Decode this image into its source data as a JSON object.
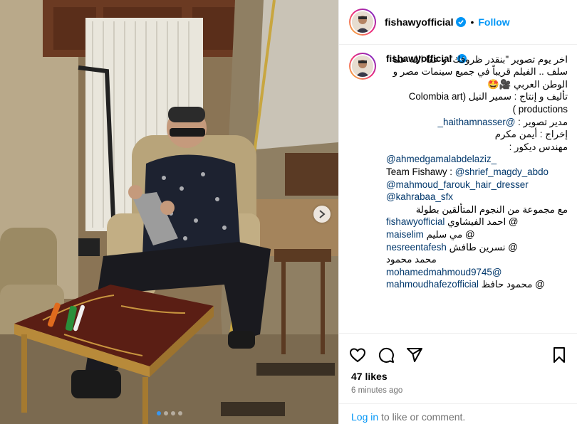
{
  "post": {
    "username": "fishawyofficial",
    "separator": "•",
    "follow_label": "Follow",
    "caption": {
      "lines": [
        {
          "text": "اخر يوم تصوير \"بنقدر ظروفك\" و عفا الله عما سلف .. الفيلم قريباً في جميع سينمات مصر و الوطن العربي 🎥🤩",
          "dir": "rtl"
        },
        {
          "text": "تأليف و إنتاج : سمير النيل (Colombia art productions )",
          "dir": "rtl"
        },
        {
          "text": "مدير تصوير : @haithamnasser_",
          "dir": "rtl",
          "has_link": true,
          "plain": "مدير تصوير : ",
          "link": "@haithamnasser_"
        },
        {
          "text": "إخراج : أيمن مكرم",
          "dir": "rtl"
        },
        {
          "text": "مهندس ديكور :",
          "dir": "rtl"
        },
        {
          "text": "@ahmedgamalabdelaziz_",
          "dir": "ltr",
          "link_only": true
        },
        {
          "text": "Team Fishawy :",
          "dir": "ltr"
        },
        {
          "text": "مع مجموعة من النجوم المتألقين بطولة",
          "dir": "rtl"
        },
        {
          "text": "احمد الفيشاوي",
          "dir": "ltr"
        },
        {
          "text": "مي سليم",
          "dir": "ltr"
        },
        {
          "text": "نسرين طافش",
          "dir": "ltr"
        },
        {
          "text": "محمد محمود",
          "dir": "ltr"
        },
        {
          "text": "محمود حافظ",
          "dir": "ltr"
        }
      ],
      "team_links": [
        "@shrief_magdy_abdo",
        "@mahmoud_farouk_hair_dresser",
        "@kahrabaa_sfx"
      ],
      "cast": [
        {
          "link": "fishawyofficial",
          "name": "احمد الفيشاوي @"
        },
        {
          "link": "maiselim",
          "name": "مي سليم @"
        },
        {
          "link": "nesreentafesh",
          "name": "نسرين طافش @"
        },
        {
          "name_only": "محمد محمود"
        },
        {
          "link": "mohamedmahmoud9745@"
        },
        {
          "link": "mahmoudhafezofficial",
          "name": "محمود حافظ @"
        }
      ]
    },
    "likes": "47 likes",
    "time_ago": "6 minutes ago",
    "login": {
      "link": "Log in",
      "rest": " to like or comment."
    }
  },
  "carousel": {
    "total": 4,
    "active": 0
  },
  "colors": {
    "accent": "#0095f6",
    "verified": "#0095f6",
    "link": "#00376b",
    "muted": "#737373"
  },
  "icons": [
    "verified-badge-icon",
    "heart-icon",
    "comment-icon",
    "share-icon",
    "bookmark-icon",
    "chevron-right-icon"
  ]
}
